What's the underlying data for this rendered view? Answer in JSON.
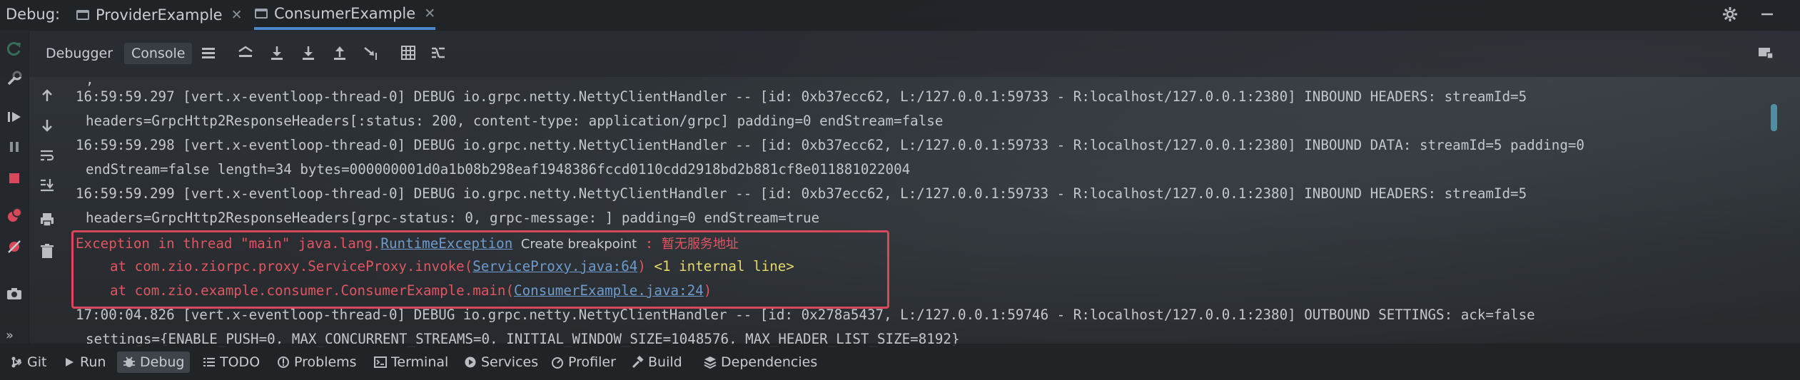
{
  "topbar": {
    "debug_label": "Debug:",
    "tabs": [
      {
        "label": "ProviderExample",
        "active": false
      },
      {
        "label": "ConsumerExample",
        "active": true
      }
    ]
  },
  "toolbar": {
    "debugger_label": "Debugger",
    "console_label": "Console"
  },
  "console": {
    "lines": [
      ",",
      "16:59:59.297 [vert.x-eventloop-thread-0] DEBUG io.grpc.netty.NettyClientHandler -- [id: 0xb37ecc62, L:/127.0.0.1:59733 - R:localhost/127.0.0.1:2380] INBOUND HEADERS: streamId=5",
      "headers=GrpcHttp2ResponseHeaders[:status: 200, content-type: application/grpc] padding=0 endStream=false",
      "16:59:59.298 [vert.x-eventloop-thread-0] DEBUG io.grpc.netty.NettyClientHandler -- [id: 0xb37ecc62, L:/127.0.0.1:59733 - R:localhost/127.0.0.1:2380] INBOUND DATA: streamId=5 padding=0",
      "endStream=false length=34 bytes=000000001d0a1b08b298eaf1948386fccd0110cdd2918bd2b881cf8e011881022004",
      "16:59:59.299 [vert.x-eventloop-thread-0] DEBUG io.grpc.netty.NettyClientHandler -- [id: 0xb37ecc62, L:/127.0.0.1:59733 - R:localhost/127.0.0.1:2380] INBOUND HEADERS: streamId=5",
      "headers=GrpcHttp2ResponseHeaders[grpc-status: 0, grpc-message: ] padding=0 endStream=true",
      "17:00:04.826 [vert.x-eventloop-thread-0] DEBUG io.grpc.netty.NettyClientHandler -- [id: 0x278a5437, L:/127.0.0.1:59746 - R:localhost/127.0.0.1:2380] OUTBOUND SETTINGS: ack=false",
      "settings={ENABLE_PUSH=0, MAX_CONCURRENT_STREAMS=0, INITIAL_WINDOW_SIZE=1048576, MAX_HEADER_LIST_SIZE=8192}"
    ],
    "exception": {
      "prefix": "Exception in thread \"main\" java.lang.",
      "class_link": "RuntimeException",
      "create_breakpoint": "Create breakpoint",
      "separator": " : ",
      "message": "暂无服务地址",
      "frame1_prefix": "at com.zio.ziorpc.proxy.ServiceProxy.invoke(",
      "frame1_link": "ServiceProxy.java:64",
      "frame1_suffix": ")",
      "frame1_internal": "<1 internal line>",
      "frame2_prefix": "at com.zio.example.consumer.ConsumerExample.main(",
      "frame2_link": "ConsumerExample.java:24",
      "frame2_suffix": ")"
    }
  },
  "bottombar": {
    "items": [
      {
        "label": "Git",
        "icon": "git-icon"
      },
      {
        "label": "Run",
        "icon": "run-icon"
      },
      {
        "label": "Debug",
        "icon": "debug-icon",
        "active": true
      },
      {
        "label": "TODO",
        "icon": "todo-icon"
      },
      {
        "label": "Problems",
        "icon": "problems-icon"
      },
      {
        "label": "Terminal",
        "icon": "terminal-icon"
      },
      {
        "label": "Services",
        "icon": "services-icon"
      },
      {
        "label": "Profiler",
        "icon": "profiler-icon"
      },
      {
        "label": "Build",
        "icon": "build-icon"
      },
      {
        "label": "Dependencies",
        "icon": "dependencies-icon"
      }
    ],
    "more_label": "»"
  },
  "colors": {
    "exception_red": "#e05561",
    "link_blue": "#6e9bcc",
    "internal_yellow": "#e4d86a",
    "highlight_border": "#d9485a",
    "active_tab_underline": "#4a88c7"
  }
}
